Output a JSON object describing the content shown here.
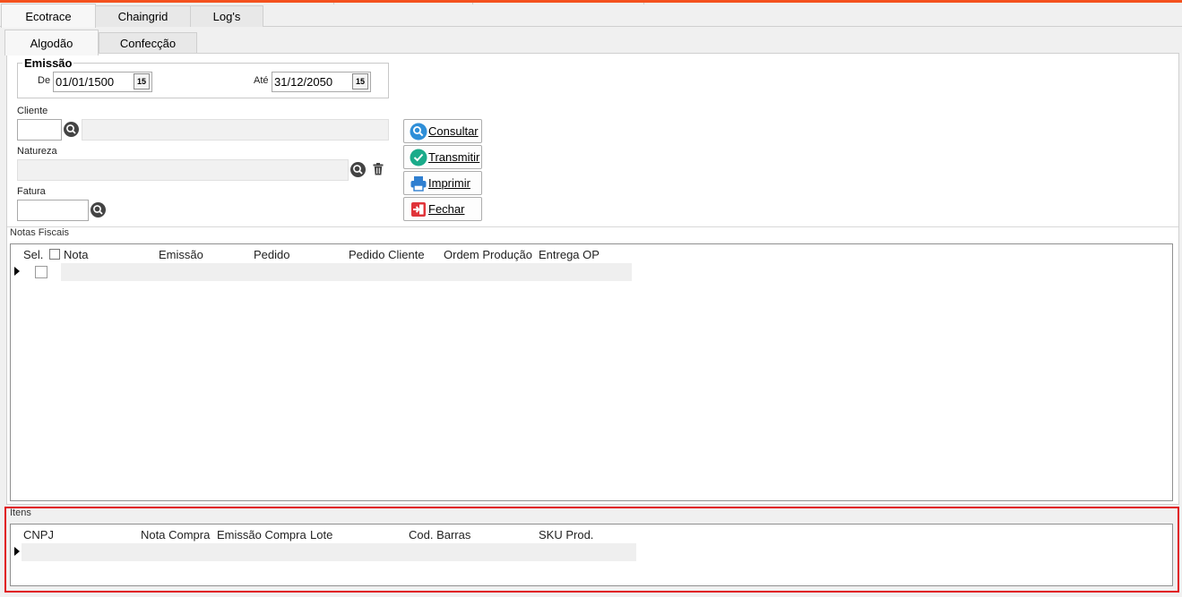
{
  "top_tabs": [
    {
      "label": "Ecotrace",
      "active": true
    },
    {
      "label": "Chaingrid",
      "active": false
    },
    {
      "label": "Log's",
      "active": false
    }
  ],
  "sub_tabs": [
    {
      "label": "Algodão",
      "active": true
    },
    {
      "label": "Confecção",
      "active": false
    }
  ],
  "emissao": {
    "title": "Emissão",
    "de_label": "De",
    "de_value": "01/01/1500",
    "ate_label": "Até",
    "ate_value": "31/12/2050",
    "calendar_glyph": "15"
  },
  "filters": {
    "cliente_label": "Cliente",
    "cliente_code": "",
    "cliente_name": "",
    "natureza_label": "Natureza",
    "natureza_value": "",
    "fatura_label": "Fatura",
    "fatura_value": ""
  },
  "buttons": {
    "consultar": "Consultar",
    "transmitir": "Transmitir",
    "imprimir": "Imprimir",
    "fechar": "Fechar"
  },
  "notas": {
    "title": "Notas Fiscais",
    "columns": [
      "Sel.",
      "Nota",
      "Emissão",
      "Pedido",
      "Pedido Cliente",
      "Ordem Produção",
      "Entrega OP"
    ]
  },
  "itens": {
    "title": "Itens",
    "columns": [
      "CNPJ",
      "Nota Compra",
      "Emissão Compra",
      "Lote",
      "Cod. Barras",
      "SKU Prod."
    ]
  },
  "colors": {
    "accent_top": "#f4511e",
    "highlight_box": "#e0121b",
    "consultar_icon": "#2f8fd8",
    "transmitir_icon": "#1aab8a",
    "imprimir_icon": "#2f7fd0",
    "fechar_icon": "#e0343a"
  }
}
